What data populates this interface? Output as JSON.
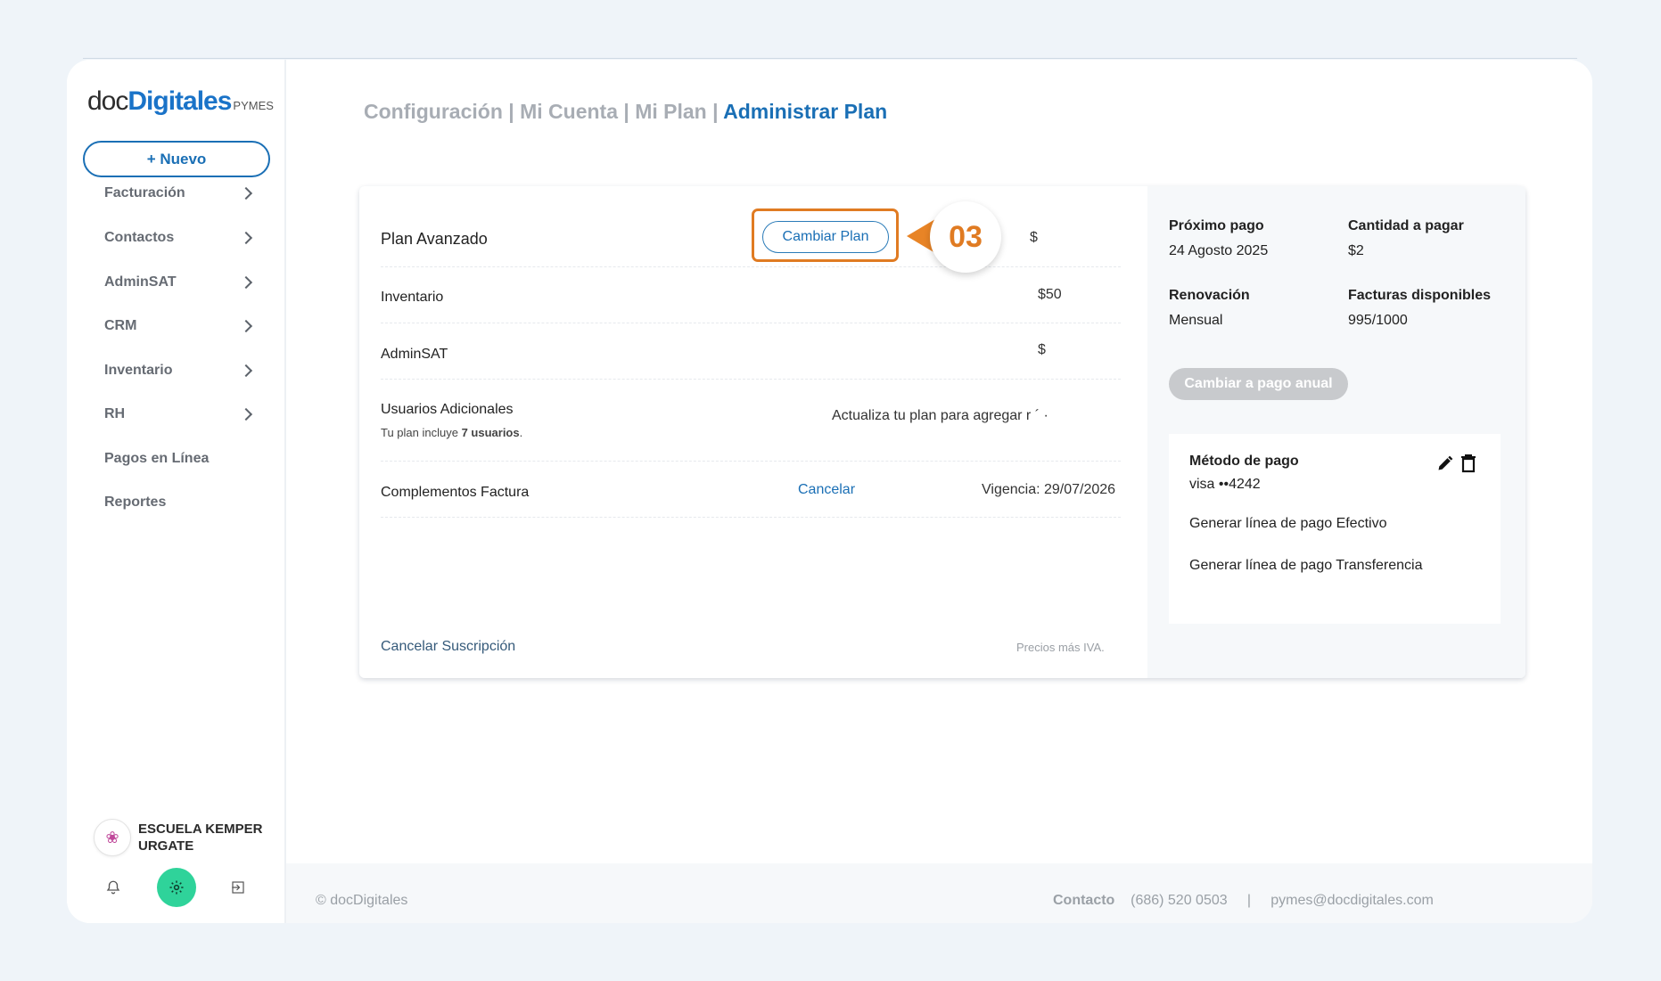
{
  "logo": {
    "part1": "doc",
    "part2": "Digitales",
    "suffix": "PYMES"
  },
  "new_button": "+ Nuevo",
  "nav": [
    {
      "label": "Facturación",
      "chevron": true
    },
    {
      "label": "Contactos",
      "chevron": true
    },
    {
      "label": "AdminSAT",
      "chevron": true
    },
    {
      "label": "CRM",
      "chevron": true
    },
    {
      "label": "Inventario",
      "chevron": true
    },
    {
      "label": "RH",
      "chevron": true
    },
    {
      "label": "Pagos en Línea",
      "chevron": false
    },
    {
      "label": "Reportes",
      "chevron": false
    }
  ],
  "org": {
    "name": "ESCUELA KEMPER URGATE"
  },
  "breadcrumb": {
    "c1": "Configuración",
    "c2": "Mi Cuenta",
    "c3": "Mi Plan",
    "active": "Administrar Plan",
    "sep": " | "
  },
  "plan": {
    "name": "Plan Avanzado",
    "change_button": "Cambiar Plan",
    "callout": "03",
    "price": "$",
    "rows": {
      "inventario": {
        "label": "Inventario",
        "value": "$50"
      },
      "adminsat": {
        "label": "AdminSAT",
        "value": "$"
      },
      "usuarios": {
        "label": "Usuarios Adicionales",
        "note_pre": "Tu plan incluye ",
        "note_bold": "7 usuarios",
        "note_post": ".",
        "value": "Actualiza tu plan para agregar r ´ ·"
      },
      "complementos": {
        "label": "Complementos Factura",
        "action": "Cancelar",
        "value": "Vigencia: 29/07/2026"
      }
    },
    "cancel_subscription": "Cancelar Suscripción",
    "tax_note": "Precios más IVA."
  },
  "billing": {
    "next_payment_label": "Próximo pago",
    "next_payment_value": "24 Agosto 2025",
    "amount_label": "Cantidad a pagar",
    "amount_value": "$2",
    "renewal_label": "Renovación",
    "renewal_value": "Mensual",
    "invoices_label": "Facturas disponibles",
    "invoices_value": "995/1000",
    "annual_button": "Cambiar a pago anual",
    "method_label": "Método de pago",
    "method_value": "visa ••4242",
    "cash_link": "Generar línea de pago Efectivo",
    "transfer_link": "Generar línea de pago Transferencia"
  },
  "footer": {
    "copyright": "© docDigitales",
    "contact_label": "Contacto",
    "phone": "(686) 520 0503",
    "separator": "|",
    "email": "pymes@docdigitales.com"
  },
  "colors": {
    "accent": "#1a6fb5",
    "callout": "#e07b22",
    "gear": "#2fd39a"
  },
  "icons": [
    "bell-icon",
    "gear-icon",
    "logout-icon",
    "edit-icon",
    "trash-icon",
    "chevron-right-icon"
  ]
}
